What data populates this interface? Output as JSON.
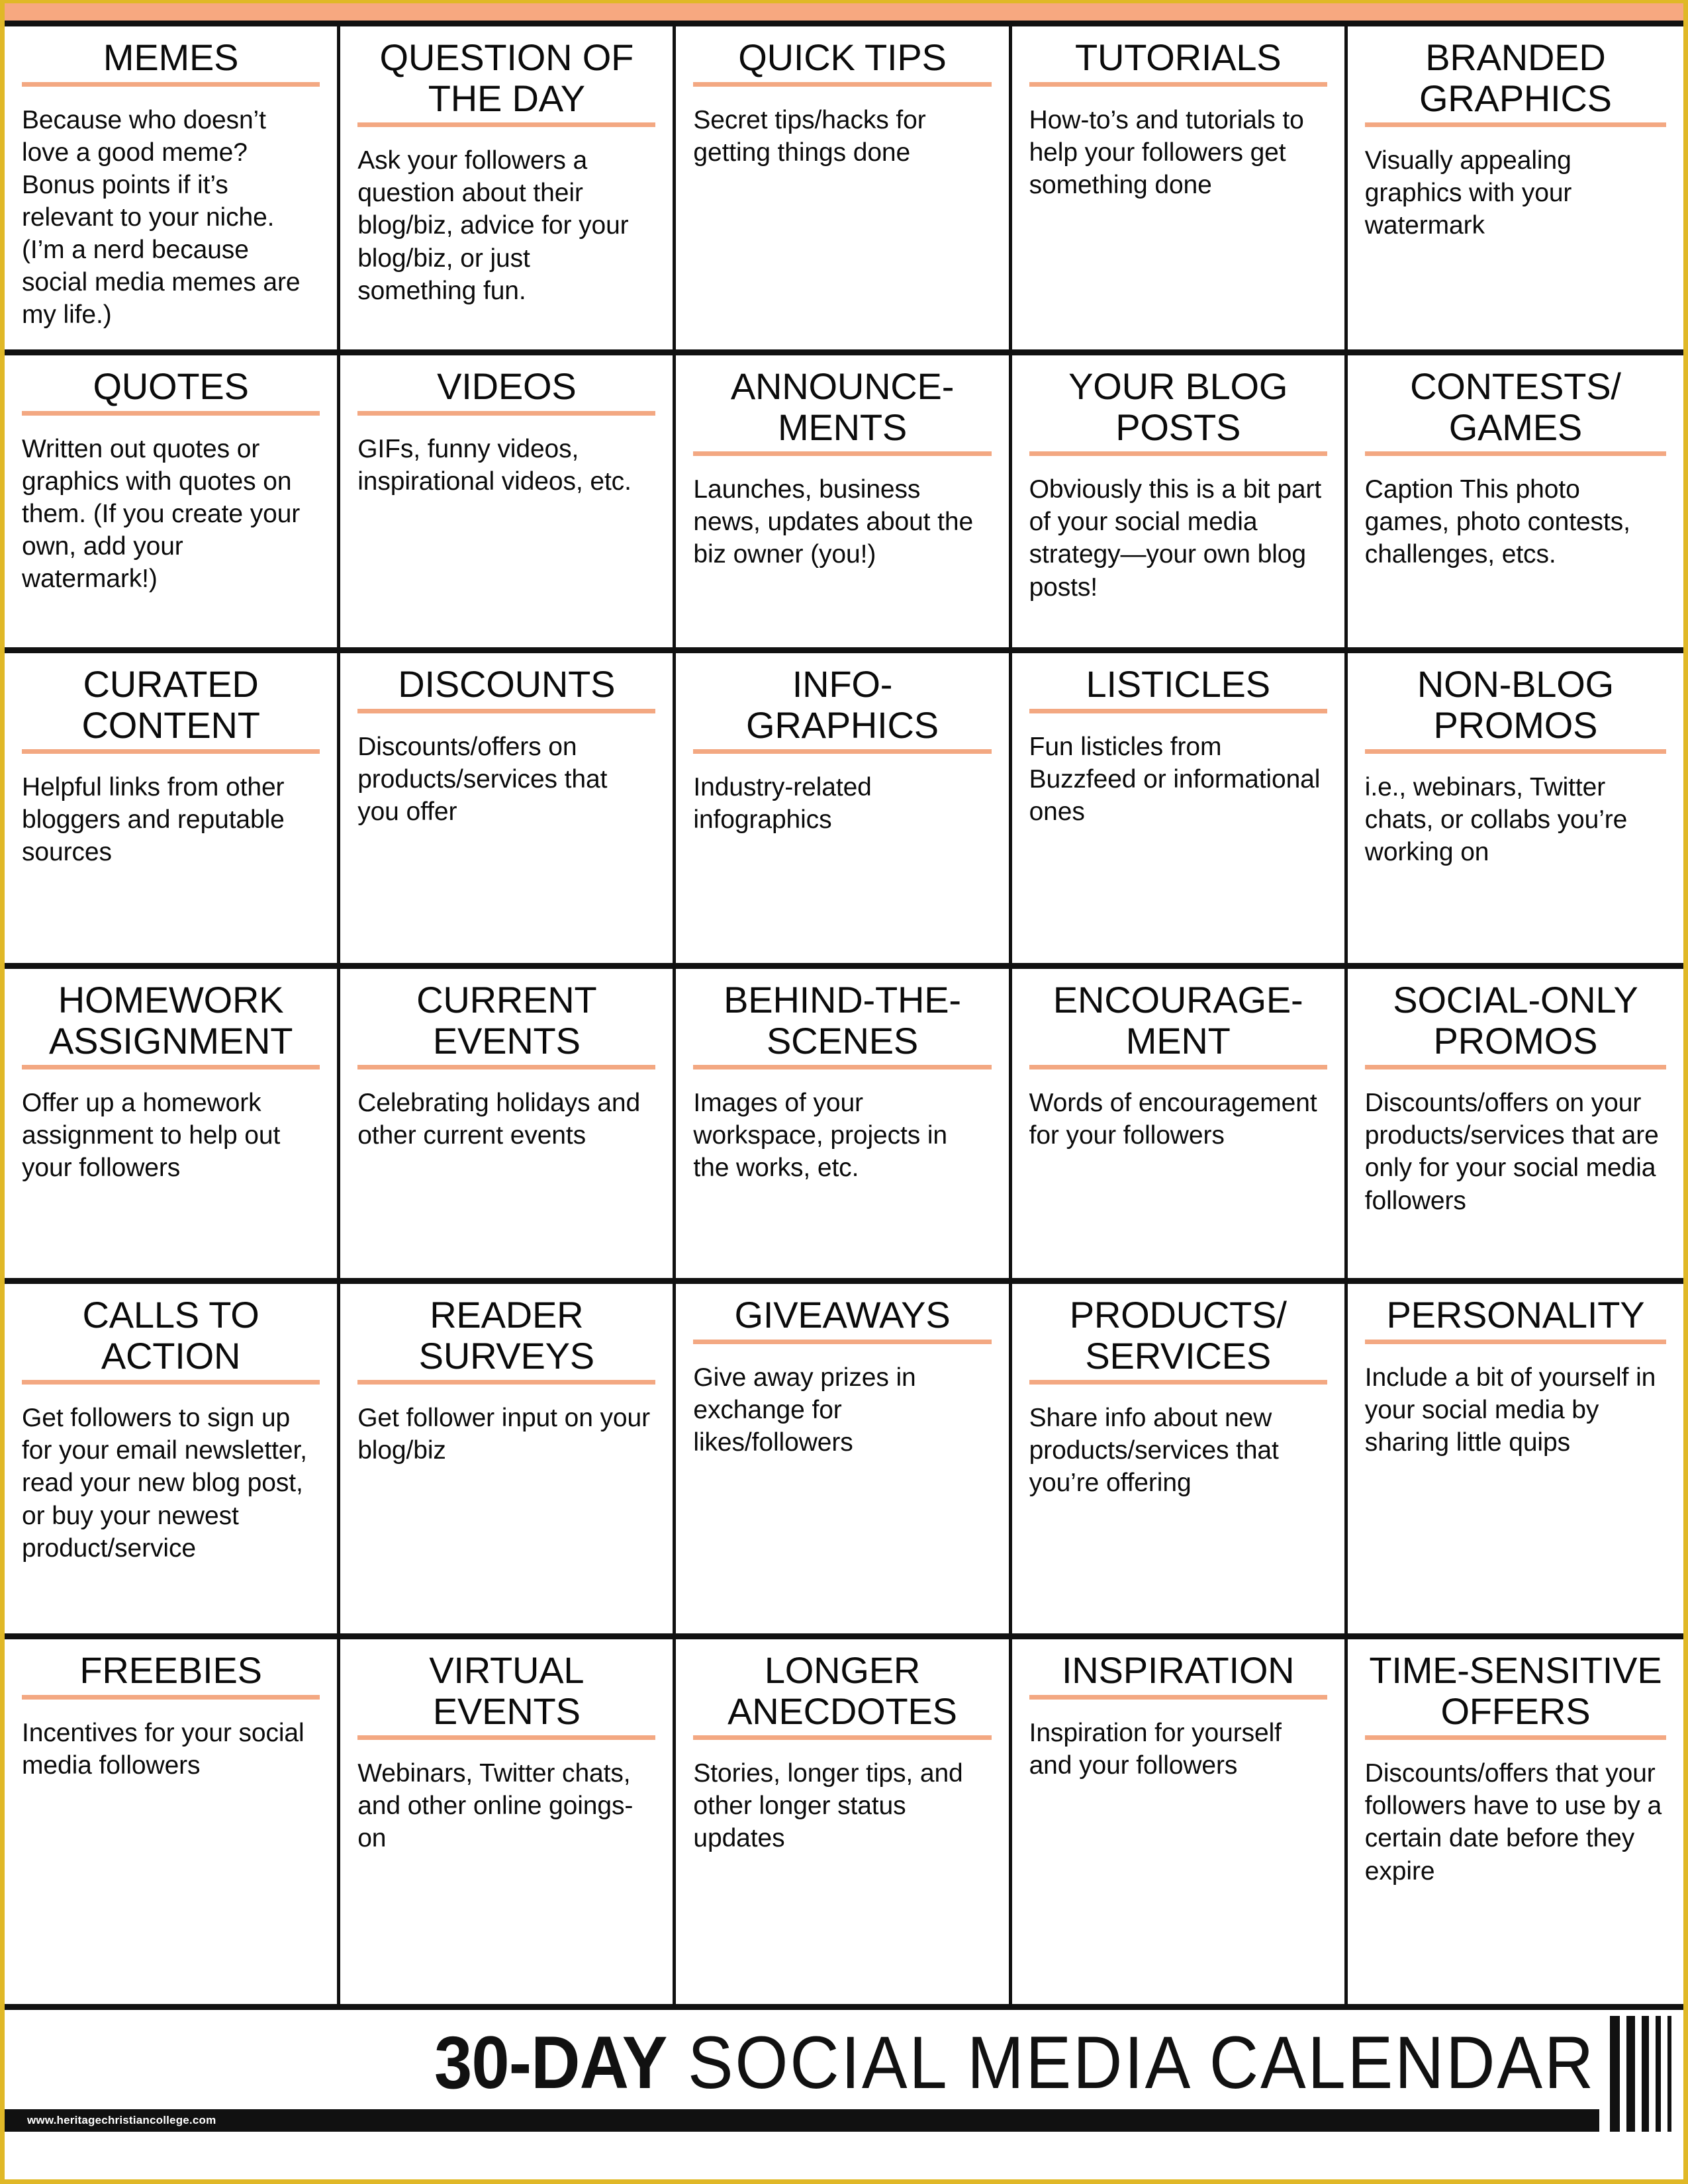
{
  "page": {
    "border_color": "#E0B827",
    "banner_color": "#F7A880",
    "accent_rule_color": "#F3A882",
    "ink_color": "#111111"
  },
  "footer": {
    "title_bold": "30-DAY",
    "title_light": " SOCIAL MEDIA CALENDAR",
    "watermark": "www.heritagechristiancollege.com"
  },
  "grid": {
    "columns": 5,
    "rows": 6,
    "cells": [
      {
        "title": "MEMES",
        "desc": "Because who doesn’t love a good meme? Bonus points if it’s relevant to your niche. (I’m a nerd because social media memes are my life.)"
      },
      {
        "title": "QUESTION OF THE DAY",
        "desc": "Ask your followers a question about their blog/biz, advice for your blog/biz, or just something fun."
      },
      {
        "title": "QUICK TIPS",
        "desc": "Secret tips/hacks for getting things done"
      },
      {
        "title": "TUTORIALS",
        "desc": "How-to’s and tutorials to help your followers get something done"
      },
      {
        "title": "BRANDED GRAPHICS",
        "desc": "Visually appealing graphics with your watermark"
      },
      {
        "title": "QUOTES",
        "desc": "Written out quotes or graphics with quotes on them. (If you create your own, add your watermark!)"
      },
      {
        "title": "VIDEOS",
        "desc": "GIFs, funny videos, inspirational videos, etc."
      },
      {
        "title": "ANNOUNCE-MENTS",
        "desc": "Launches, business news, updates about the biz owner (you!)"
      },
      {
        "title": "YOUR BLOG POSTS",
        "desc": "Obviously this is a bit part of your social media strategy—your own blog posts!"
      },
      {
        "title": "CONTESTS/ GAMES",
        "desc": "Caption This photo games, photo contests, challenges, etcs."
      },
      {
        "title": "CURATED CONTENT",
        "desc": "Helpful links from other bloggers and reputable sources"
      },
      {
        "title": "DISCOUNTS",
        "desc": "Discounts/offers on products/services that you offer"
      },
      {
        "title": "INFO-GRAPHICS",
        "desc": "Industry-related infographics"
      },
      {
        "title": "LISTICLES",
        "desc": "Fun listicles from Buzzfeed or informational ones"
      },
      {
        "title": "NON-BLOG PROMOS",
        "desc": "i.e., webinars, Twitter chats, or collabs you’re working on"
      },
      {
        "title": "HOMEWORK ASSIGNMENT",
        "desc": "Offer up a homework assignment to help out your followers"
      },
      {
        "title": "CURRENT EVENTS",
        "desc": "Celebrating holidays and other current events"
      },
      {
        "title": "BEHIND-THE-SCENES",
        "desc": "Images of your workspace, projects in the works, etc."
      },
      {
        "title": "ENCOURAGE-MENT",
        "desc": "Words of encouragement for your followers"
      },
      {
        "title": "SOCIAL-ONLY PROMOS",
        "desc": "Discounts/offers on your products/services that are only for your social media followers"
      },
      {
        "title": "CALLS TO ACTION",
        "desc": "Get followers to sign up for your email newsletter, read your new blog post, or buy your newest product/service"
      },
      {
        "title": "READER SURVEYS",
        "desc": "Get follower input on your blog/biz"
      },
      {
        "title": "GIVEAWAYS",
        "desc": "Give away prizes in exchange for likes/followers"
      },
      {
        "title": "PRODUCTS/ SERVICES",
        "desc": "Share info about new products/services that you’re offering"
      },
      {
        "title": "PERSONALITY",
        "desc": "Include a bit of yourself in your social media by sharing little quips"
      },
      {
        "title": "FREEBIES",
        "desc": "Incentives for your social media followers"
      },
      {
        "title": "VIRTUAL EVENTS",
        "desc": "Webinars, Twitter chats, and other online goings-on"
      },
      {
        "title": "LONGER ANECDOTES",
        "desc": "Stories, longer tips, and other longer status updates"
      },
      {
        "title": "INSPIRATION",
        "desc": "Inspiration for yourself and your followers"
      },
      {
        "title": "TIME-SENSITIVE OFFERS",
        "desc": "Discounts/offers that your followers have to use by a certain date before they expire"
      }
    ]
  }
}
